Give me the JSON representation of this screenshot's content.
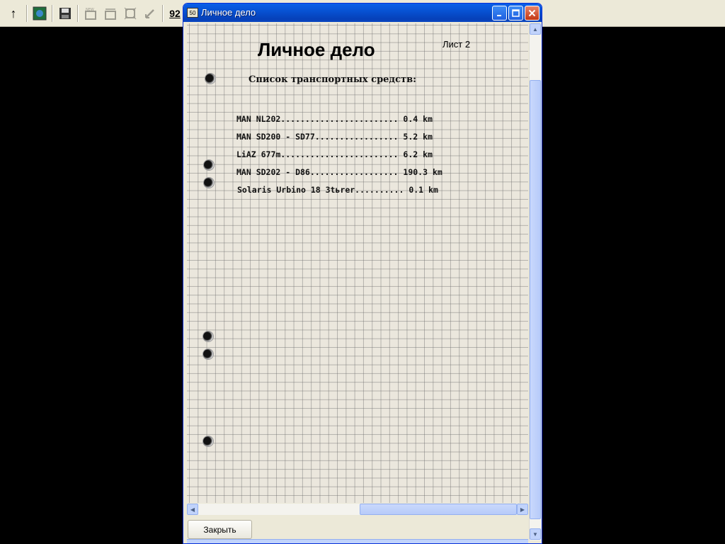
{
  "toolbar": {
    "badge_text": "92"
  },
  "window": {
    "title": "Личное дело",
    "icon_text": "50"
  },
  "document": {
    "heading": "Личное дело",
    "sheet": "Лист 2",
    "subtitle": "Список транспортных средств:",
    "vehicles": [
      "MAN NL202........................ 0.4 km",
      "MAN SD200 - SD77................. 5.2 km",
      "LiAZ 677m........................ 6.2 km",
      "MAN SD202 - D86.................. 190.3 km",
      "Solaris Urbino 18 3tьrer.......... 0.1 km"
    ]
  },
  "buttons": {
    "close_label": "Закрыть"
  }
}
